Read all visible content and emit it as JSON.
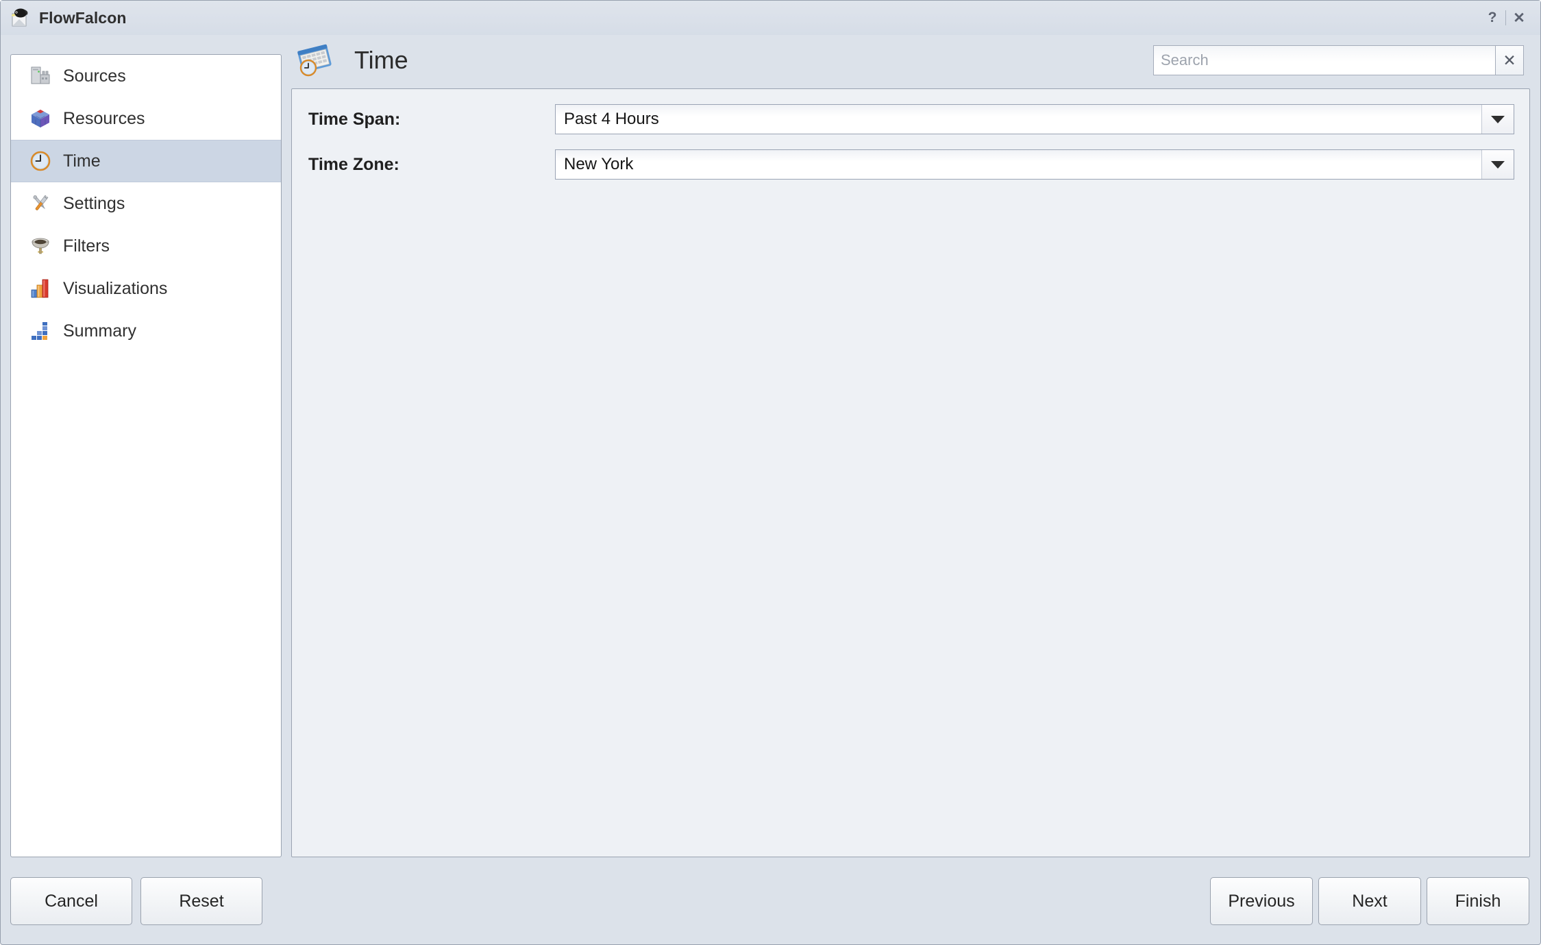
{
  "window": {
    "title": "FlowFalcon",
    "app_icon": "falcon-icon",
    "help_label": "?",
    "close_label": "✕"
  },
  "sidebar": {
    "items": [
      {
        "label": "Sources",
        "icon": "server-icon",
        "selected": false
      },
      {
        "label": "Resources",
        "icon": "cube-icon",
        "selected": false
      },
      {
        "label": "Time",
        "icon": "clock-icon",
        "selected": true
      },
      {
        "label": "Settings",
        "icon": "tools-icon",
        "selected": false
      },
      {
        "label": "Filters",
        "icon": "funnel-icon",
        "selected": false
      },
      {
        "label": "Visualizations",
        "icon": "bar-chart-icon",
        "selected": false
      },
      {
        "label": "Summary",
        "icon": "blocks-icon",
        "selected": false
      }
    ]
  },
  "header": {
    "title": "Time",
    "icon": "calendar-clock-icon"
  },
  "search": {
    "value": "",
    "placeholder": "Search",
    "clear_label": "✕"
  },
  "form": {
    "rows": [
      {
        "label": "Time Span:",
        "value": "Past 4 Hours"
      },
      {
        "label": "Time Zone:",
        "value": "New York"
      }
    ]
  },
  "footer": {
    "cancel_label": "Cancel",
    "reset_label": "Reset",
    "previous_label": "Previous",
    "next_label": "Next",
    "finish_label": "Finish"
  },
  "colors": {
    "window_bg": "#dce2ea",
    "panel_bg": "#eef1f5",
    "sidebar_bg": "#ffffff",
    "selection": "#ccd6e4",
    "border": "#9aa3b1",
    "text": "#2b2b2b"
  }
}
